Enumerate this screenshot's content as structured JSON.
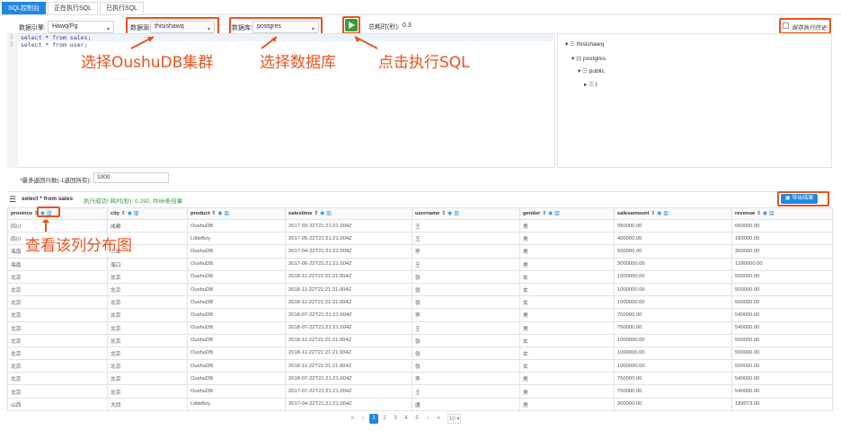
{
  "tabs": [
    "SQL控制台",
    "正在执行SQL",
    "已执行SQL"
  ],
  "toolbar": {
    "engine_label": "数据引擎:",
    "engine_value": "Hawq/Pg",
    "datasource_label": "数据源:",
    "datasource_value": "thisishawq",
    "database_label": "数据库:",
    "database_value": "postgres",
    "elapsed_label": "总耗时(秒):",
    "elapsed_value": "0.3",
    "save_history_label": "保存执行历史"
  },
  "editor": {
    "lines": [
      "select * from sales;",
      "select * from user;"
    ],
    "line_numbers": [
      "1",
      "2"
    ]
  },
  "tree": {
    "nodes": [
      "thisishawq",
      "postgres",
      "public",
      "t"
    ]
  },
  "annotations": {
    "select_cluster": "选择OushuDB集群",
    "select_database": "选择数据库",
    "click_run": "点击执行SQL",
    "view_distribution": "查看该列分布图"
  },
  "max_rows": {
    "label": "*最多返回行数(-1返回所有):",
    "value": "1000"
  },
  "result": {
    "sql": "select * from sales",
    "status": "执行成功!  耗时(秒): 0.292,  共66条结果",
    "export_label": "导出结果"
  },
  "table": {
    "columns": [
      "province",
      "city",
      "product",
      "salestime",
      "username",
      "gender",
      "salesamount",
      "revenue"
    ],
    "rows": [
      [
        "四川",
        "成都",
        "OushuDB",
        "2017-03-22T21:21:21.004Z",
        "王",
        "男",
        "950000.00",
        "660000.00"
      ],
      [
        "四川",
        "",
        "LittleBoy",
        "2017-05-22T21:21:21.004Z",
        "王",
        "男",
        "400000.00",
        "183000.00"
      ],
      [
        "海南",
        "三亚",
        "OushuDB",
        "2017-04-22T21:21:21.004Z",
        "李",
        "男",
        "600000.00",
        "360000.00"
      ],
      [
        "海南",
        "海口",
        "OushuDB",
        "2017-06-22T21:21:21.004Z",
        "王",
        "男",
        "3000000.00",
        "1280000.00"
      ],
      [
        "北京",
        "北京",
        "OushuDB",
        "2018-11-22T21:21:21.004Z",
        "张",
        "女",
        "1000000.00",
        "500000.00"
      ],
      [
        "北京",
        "北京",
        "OushuDB",
        "2018-11-22T21:21:21.004Z",
        "张",
        "女",
        "1000000.00",
        "500000.00"
      ],
      [
        "北京",
        "北京",
        "OushuDB",
        "2018-11-22T21:21:21.004Z",
        "张",
        "女",
        "1000000.00",
        "500000.00"
      ],
      [
        "北京",
        "北京",
        "OushuDB",
        "2018-07-22T21:21:21.004Z",
        "李",
        "男",
        "750000.00",
        "540000.00"
      ],
      [
        "北京",
        "北京",
        "OushuDB",
        "2018-07-22T21:21:21.004Z",
        "王",
        "男",
        "750000.00",
        "540000.00"
      ],
      [
        "北京",
        "北京",
        "OushuDB",
        "2018-11-22T21:21:21.004Z",
        "张",
        "女",
        "1000000.00",
        "500000.00"
      ],
      [
        "北京",
        "北京",
        "OushuDB",
        "2018-11-22T21:21:21.004Z",
        "张",
        "女",
        "1000000.00",
        "500000.00"
      ],
      [
        "北京",
        "北京",
        "OushuDB",
        "2018-11-22T21:21:21.004Z",
        "张",
        "女",
        "1000000.00",
        "500000.00"
      ],
      [
        "北京",
        "北京",
        "OushuDB",
        "2018-07-22T21:21:21.004Z",
        "李",
        "男",
        "750000.00",
        "540000.00"
      ],
      [
        "北京",
        "北京",
        "OushuDB",
        "2017-07-22T21:21:21.004Z",
        "王",
        "男",
        "750000.00",
        "540000.00"
      ],
      [
        "山西",
        "大同",
        "LittleBoy",
        "2017-04-22T21:21:21.004Z",
        "唐",
        "男",
        "300000.00",
        "189073.00"
      ]
    ]
  },
  "pagination": {
    "items": [
      "«",
      "‹",
      "1",
      "2",
      "3",
      "4",
      "5",
      "›",
      "»"
    ],
    "current": "1",
    "page_size": "10"
  },
  "colors": {
    "accent": "#1e88e5",
    "annotation": "#e8531d",
    "run": "#3a9a3a"
  }
}
